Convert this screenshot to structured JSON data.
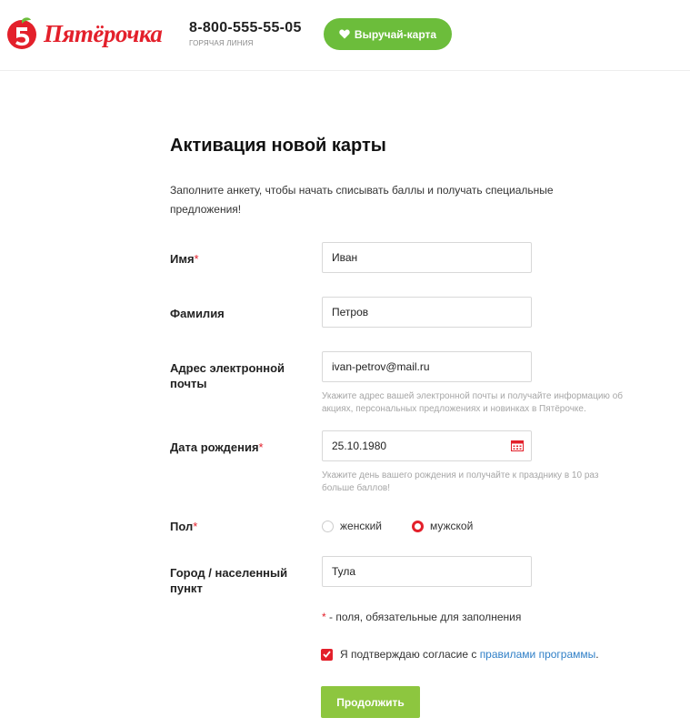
{
  "header": {
    "logo_text": "Пятёрочка",
    "phone_number": "8-800-555-55-05",
    "phone_caption": "ГОРЯЧАЯ ЛИНИЯ",
    "loyalty_button_label": "Выручай-карта",
    "brand_red": "#e3202b",
    "brand_green": "#6cbd3b"
  },
  "form": {
    "title": "Активация новой карты",
    "intro": "Заполните анкету, чтобы начать списывать баллы и получать специальные предложения!",
    "required_mark": "*",
    "fields": {
      "first_name": {
        "label": "Имя",
        "required": true,
        "value": "Иван"
      },
      "last_name": {
        "label": "Фамилия",
        "required": false,
        "value": "Петров"
      },
      "email": {
        "label": "Адрес электронной почты",
        "required": false,
        "value": "ivan-petrov@mail.ru",
        "hint": "Укажите адрес вашей электронной почты и получайте информацию об акциях, персональных предложениях и новинках в Пятёрочке."
      },
      "birth_date": {
        "label": "Дата рождения",
        "required": true,
        "value": "25.10.1980",
        "hint": "Укажите день вашего рождения и получайте к празднику в 10 раз больше баллов!",
        "icon": "calendar-icon"
      },
      "gender": {
        "label": "Пол",
        "required": true,
        "options": [
          "женский",
          "мужской"
        ],
        "selected": "мужской"
      },
      "city": {
        "label": "Город / населенный пункт",
        "required": false,
        "value": "Тула"
      }
    },
    "required_note": "- поля, обязательные для заполнения",
    "consent": {
      "checked": true,
      "text": "Я подтверждаю согласие с",
      "link_text": "правилами программы",
      "suffix": "."
    },
    "submit_label": "Продолжить",
    "submit_color": "#8dc63f"
  }
}
